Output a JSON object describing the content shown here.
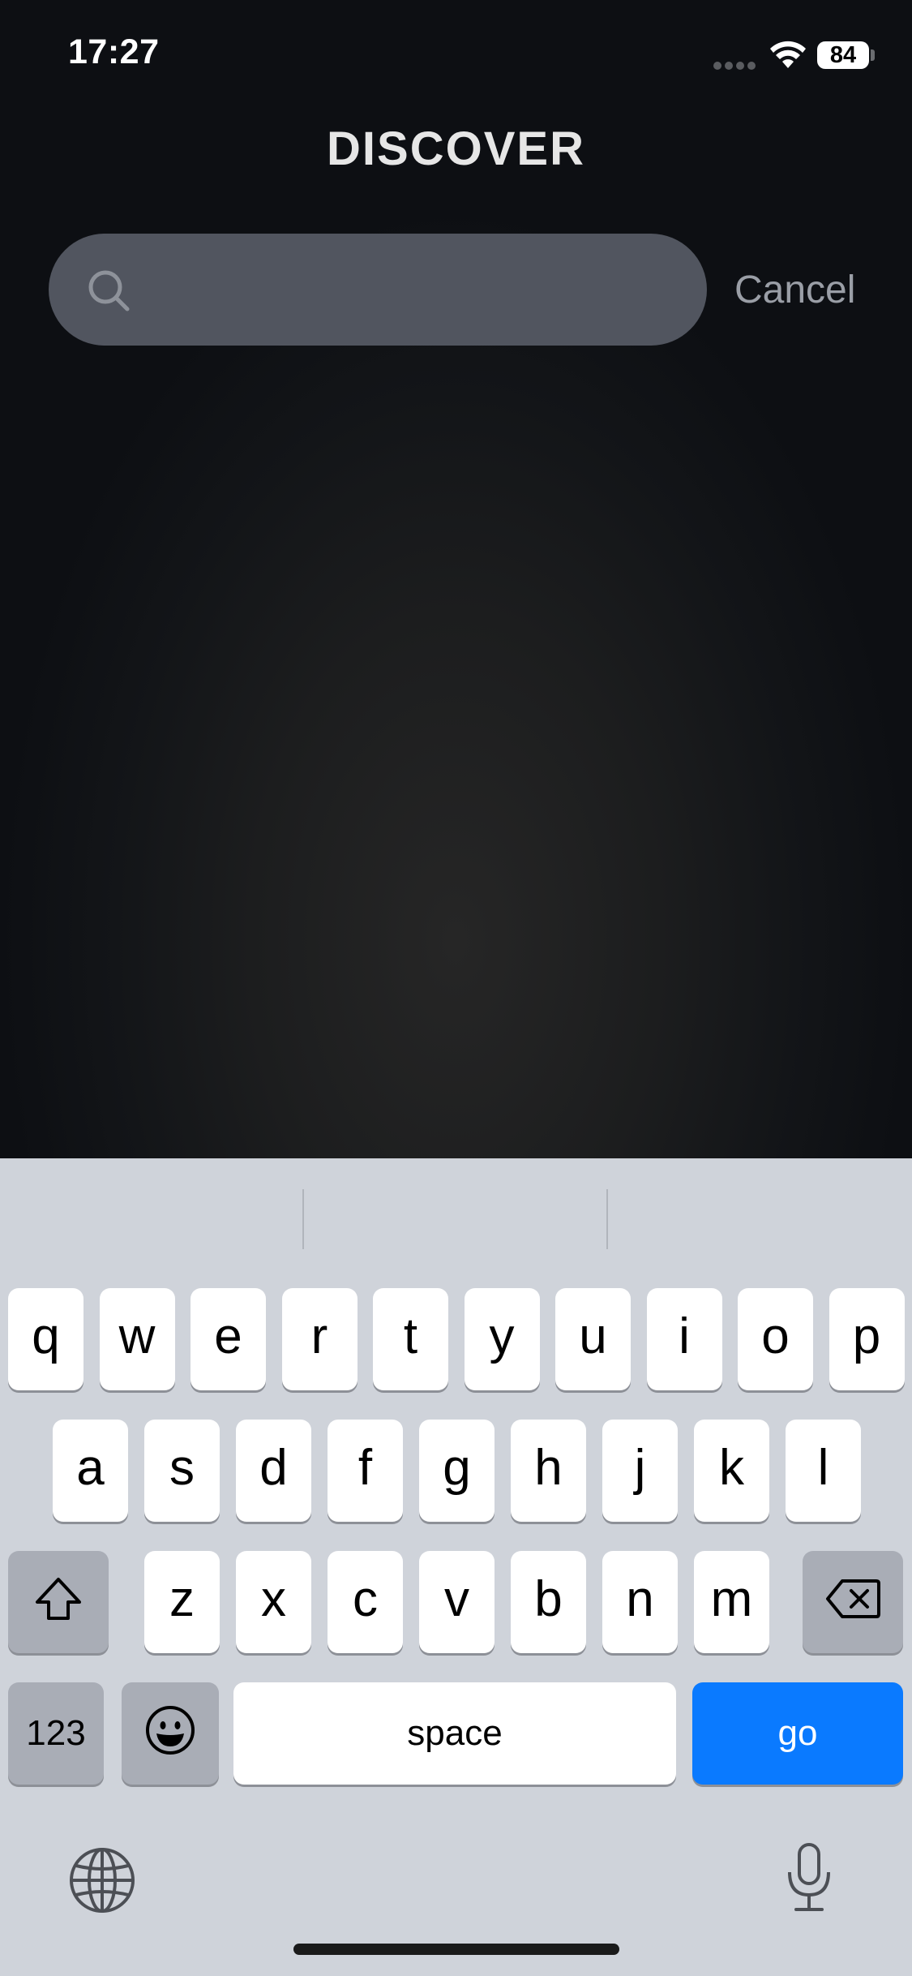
{
  "status_bar": {
    "time": "17:27",
    "battery": "84"
  },
  "header": {
    "title": "DISCOVER"
  },
  "search": {
    "value": "",
    "placeholder": "",
    "cancel_label": "Cancel"
  },
  "keyboard": {
    "row1": [
      "q",
      "w",
      "e",
      "r",
      "t",
      "y",
      "u",
      "i",
      "o",
      "p"
    ],
    "row2": [
      "a",
      "s",
      "d",
      "f",
      "g",
      "h",
      "j",
      "k",
      "l"
    ],
    "row3": [
      "z",
      "x",
      "c",
      "v",
      "b",
      "n",
      "m"
    ],
    "num_label": "123",
    "space_label": "space",
    "go_label": "go",
    "icons": {
      "shift": "shift-icon",
      "delete": "delete-icon",
      "emoji": "emoji-icon",
      "globe": "globe-icon",
      "mic": "microphone-icon"
    }
  },
  "colors": {
    "go_key": "#0a7aff",
    "search_bar": "#51555f",
    "keyboard_bg": "#cfd3da"
  }
}
